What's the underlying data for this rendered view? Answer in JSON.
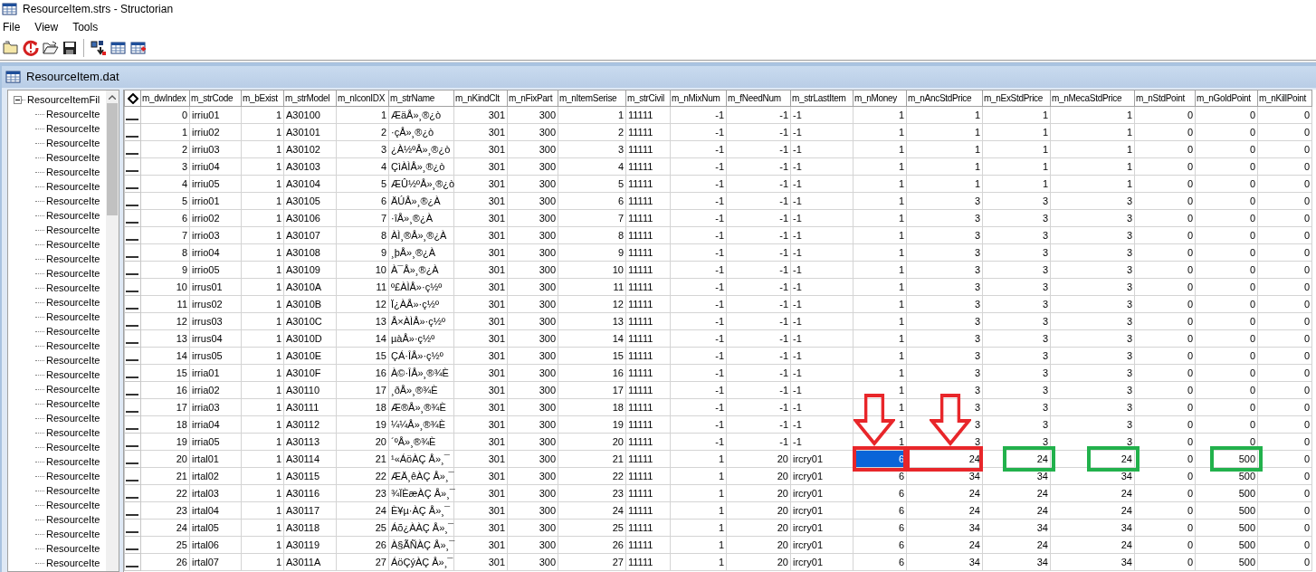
{
  "window": {
    "title": "ResourceItem.strs - Structorian"
  },
  "menu": [
    "File",
    "View",
    "Tools"
  ],
  "child_window": {
    "title": "ResourceItem.dat"
  },
  "tree": {
    "root": {
      "label": "ResourceItemFil",
      "expanded": true,
      "children": [
        "ResourceIte",
        "ResourceIte",
        "ResourceIte",
        "ResourceIte",
        "ResourceIte",
        "ResourceIte",
        "ResourceIte",
        "ResourceIte",
        "ResourceIte",
        "ResourceIte",
        "ResourceIte",
        "ResourceIte",
        "ResourceIte",
        "ResourceIte",
        "ResourceIte",
        "ResourceIte",
        "ResourceIte",
        "ResourceIte",
        "ResourceIte",
        "ResourceIte",
        "ResourceIte",
        "ResourceIte",
        "ResourceIte",
        "ResourceIte",
        "ResourceIte",
        "ResourceIte",
        "ResourceIte",
        "ResourceIte",
        "ResourceIte",
        "ResourceIte",
        "ResourceIte",
        "ResourceIte"
      ]
    }
  },
  "table": {
    "columns": [
      {
        "label": "m_dwIndex",
        "kind": "number",
        "selected": false
      },
      {
        "label": "m_strCode",
        "kind": "text",
        "selected": false
      },
      {
        "label": "m_bExist",
        "kind": "number",
        "selected": false
      },
      {
        "label": "m_strModel",
        "kind": "text",
        "selected": false
      },
      {
        "label": "m_nIconIDX",
        "kind": "number",
        "selected": false
      },
      {
        "label": "m_strName",
        "kind": "text",
        "selected": false
      },
      {
        "label": "m_nKindClt",
        "kind": "number",
        "selected": false
      },
      {
        "label": "m_nFixPart",
        "kind": "number",
        "selected": false
      },
      {
        "label": "m_nItemSerise",
        "kind": "number",
        "selected": false
      },
      {
        "label": "m_strCivil",
        "kind": "text",
        "selected": false
      },
      {
        "label": "m_nMixNum",
        "kind": "number",
        "selected": false
      },
      {
        "label": "m_fNeedNum",
        "kind": "number",
        "selected": false
      },
      {
        "label": "m_strLastItem",
        "kind": "text",
        "selected": false
      },
      {
        "label": "m_nMoney",
        "kind": "number",
        "selected": true,
        "annotation": {
          "kind": "arrow_box",
          "color": "#e8262a"
        }
      },
      {
        "label": "m_nAncStdPrice",
        "kind": "number",
        "selected": false,
        "annotation": {
          "kind": "arrow_box",
          "color": "#e8262a"
        }
      },
      {
        "label": "m_nExStdPrice",
        "kind": "number",
        "selected": false,
        "annotation": {
          "kind": "box",
          "color": "#22b14c"
        }
      },
      {
        "label": "m_nMecaStdPrice",
        "kind": "number",
        "selected": false,
        "annotation": {
          "kind": "box",
          "color": "#22b14c"
        }
      },
      {
        "label": "m_nStdPoint",
        "kind": "number",
        "selected": false
      },
      {
        "label": "m_nGoldPoint",
        "kind": "number",
        "selected": false,
        "annotation": {
          "kind": "box",
          "color": "#22b14c"
        }
      },
      {
        "label": "m_nKillPoint",
        "kind": "number",
        "selected": false
      }
    ],
    "rows": [
      {
        "selected": false,
        "annotated": false,
        "cells": [
          "0",
          "irriu01",
          "1",
          "A30100",
          "1",
          "ÆäÅ»¸®¿ò",
          "301",
          "300",
          "1",
          "11111",
          "-1",
          "-1",
          "-1",
          "1",
          "1",
          "1",
          "1",
          "0",
          "0",
          "0"
        ]
      },
      {
        "selected": false,
        "annotated": false,
        "cells": [
          "1",
          "irriu02",
          "1",
          "A30101",
          "2",
          "·çÅ»¸®¿ò",
          "301",
          "300",
          "2",
          "11111",
          "-1",
          "-1",
          "-1",
          "1",
          "1",
          "1",
          "1",
          "0",
          "0",
          "0"
        ]
      },
      {
        "selected": false,
        "annotated": false,
        "cells": [
          "2",
          "irriu03",
          "1",
          "A30102",
          "3",
          "¿À½ºÅ»¸®¿ò",
          "301",
          "300",
          "3",
          "11111",
          "-1",
          "-1",
          "-1",
          "1",
          "1",
          "1",
          "1",
          "0",
          "0",
          "0"
        ]
      },
      {
        "selected": false,
        "annotated": false,
        "cells": [
          "3",
          "irriu04",
          "1",
          "A30103",
          "4",
          "ÇìÀÌÅ»¸®¿ò",
          "301",
          "300",
          "4",
          "11111",
          "-1",
          "-1",
          "-1",
          "1",
          "1",
          "1",
          "1",
          "0",
          "0",
          "0"
        ]
      },
      {
        "selected": false,
        "annotated": false,
        "cells": [
          "4",
          "irriu05",
          "1",
          "A30104",
          "5",
          "ÆÛ½ºÅ»¸®¿ò",
          "301",
          "300",
          "5",
          "11111",
          "-1",
          "-1",
          "-1",
          "1",
          "1",
          "1",
          "1",
          "0",
          "0",
          "0"
        ]
      },
      {
        "selected": false,
        "annotated": false,
        "cells": [
          "5",
          "irrio01",
          "1",
          "A30105",
          "6",
          "ÄÚÅ»¸®¿À",
          "301",
          "300",
          "6",
          "11111",
          "-1",
          "-1",
          "-1",
          "1",
          "3",
          "3",
          "3",
          "0",
          "0",
          "0"
        ]
      },
      {
        "selected": false,
        "annotated": false,
        "cells": [
          "6",
          "irrio02",
          "1",
          "A30106",
          "7",
          "·îÅ»¸®¿À",
          "301",
          "300",
          "7",
          "11111",
          "-1",
          "-1",
          "-1",
          "1",
          "3",
          "3",
          "3",
          "0",
          "0",
          "0"
        ]
      },
      {
        "selected": false,
        "annotated": false,
        "cells": [
          "7",
          "irrio03",
          "1",
          "A30107",
          "8",
          "ÀÌ¸®Å»¸®¿À",
          "301",
          "300",
          "8",
          "11111",
          "-1",
          "-1",
          "-1",
          "1",
          "3",
          "3",
          "3",
          "0",
          "0",
          "0"
        ]
      },
      {
        "selected": false,
        "annotated": false,
        "cells": [
          "8",
          "irrio04",
          "1",
          "A30108",
          "9",
          "¸þÅ»¸®¿À",
          "301",
          "300",
          "9",
          "11111",
          "-1",
          "-1",
          "-1",
          "1",
          "3",
          "3",
          "3",
          "0",
          "0",
          "0"
        ]
      },
      {
        "selected": false,
        "annotated": false,
        "cells": [
          "9",
          "irrio05",
          "1",
          "A30109",
          "10",
          "À¯Å»¸®¿À",
          "301",
          "300",
          "10",
          "11111",
          "-1",
          "-1",
          "-1",
          "1",
          "3",
          "3",
          "3",
          "0",
          "0",
          "0"
        ]
      },
      {
        "selected": false,
        "annotated": false,
        "cells": [
          "10",
          "irrus01",
          "1",
          "A3010A",
          "11",
          "º£ÀÌÅ»·ç½º",
          "301",
          "300",
          "11",
          "11111",
          "-1",
          "-1",
          "-1",
          "1",
          "3",
          "3",
          "3",
          "0",
          "0",
          "0"
        ]
      },
      {
        "selected": false,
        "annotated": false,
        "cells": [
          "11",
          "irrus02",
          "1",
          "A3010B",
          "12",
          "Ï¿ÀÅ»·ç½º",
          "301",
          "300",
          "12",
          "11111",
          "-1",
          "-1",
          "-1",
          "1",
          "3",
          "3",
          "3",
          "0",
          "0",
          "0"
        ]
      },
      {
        "selected": false,
        "annotated": false,
        "cells": [
          "12",
          "irrus03",
          "1",
          "A3010C",
          "13",
          "Å×ÀÌÅ»·ç½º",
          "301",
          "300",
          "13",
          "11111",
          "-1",
          "-1",
          "-1",
          "1",
          "3",
          "3",
          "3",
          "0",
          "0",
          "0"
        ]
      },
      {
        "selected": false,
        "annotated": false,
        "cells": [
          "13",
          "irrus04",
          "1",
          "A3010D",
          "14",
          "µàÅ»·ç½º",
          "301",
          "300",
          "14",
          "11111",
          "-1",
          "-1",
          "-1",
          "1",
          "3",
          "3",
          "3",
          "0",
          "0",
          "0"
        ]
      },
      {
        "selected": false,
        "annotated": false,
        "cells": [
          "14",
          "irrus05",
          "1",
          "A3010E",
          "15",
          "ÇÁ·ÎÅ»·ç½º",
          "301",
          "300",
          "15",
          "11111",
          "-1",
          "-1",
          "-1",
          "1",
          "3",
          "3",
          "3",
          "0",
          "0",
          "0"
        ]
      },
      {
        "selected": false,
        "annotated": false,
        "cells": [
          "15",
          "irria01",
          "1",
          "A3010F",
          "16",
          "À©·ÎÅ»¸®¾È",
          "301",
          "300",
          "16",
          "11111",
          "-1",
          "-1",
          "-1",
          "1",
          "3",
          "3",
          "3",
          "0",
          "0",
          "0"
        ]
      },
      {
        "selected": false,
        "annotated": false,
        "cells": [
          "16",
          "irria02",
          "1",
          "A30110",
          "17",
          "¸ðÅ»¸®¾È",
          "301",
          "300",
          "17",
          "11111",
          "-1",
          "-1",
          "-1",
          "1",
          "3",
          "3",
          "3",
          "0",
          "0",
          "0"
        ]
      },
      {
        "selected": false,
        "annotated": false,
        "cells": [
          "17",
          "irria03",
          "1",
          "A30111",
          "18",
          "Æ®Å»¸®¾È",
          "301",
          "300",
          "18",
          "11111",
          "-1",
          "-1",
          "-1",
          "1",
          "3",
          "3",
          "3",
          "0",
          "0",
          "0"
        ]
      },
      {
        "selected": false,
        "annotated": false,
        "cells": [
          "18",
          "irria04",
          "1",
          "A30112",
          "19",
          "¼¼Å»¸®¾È",
          "301",
          "300",
          "19",
          "11111",
          "-1",
          "-1",
          "-1",
          "1",
          "3",
          "3",
          "3",
          "0",
          "0",
          "0"
        ]
      },
      {
        "selected": false,
        "annotated": false,
        "cells": [
          "19",
          "irria05",
          "1",
          "A30113",
          "20",
          "´ºÅ»¸®¾È",
          "301",
          "300",
          "20",
          "11111",
          "-1",
          "-1",
          "-1",
          "1",
          "3",
          "3",
          "3",
          "0",
          "0",
          "0"
        ]
      },
      {
        "selected": true,
        "annotated": true,
        "cells": [
          "20",
          "irtal01",
          "1",
          "A30114",
          "21",
          "¹«ÁöÀÇ Å»¸¯",
          "301",
          "300",
          "21",
          "11111",
          "1",
          "20",
          "ircry01",
          "6",
          "24",
          "24",
          "24",
          "0",
          "500",
          "0"
        ]
      },
      {
        "selected": false,
        "annotated": false,
        "cells": [
          "21",
          "irtal02",
          "1",
          "A30115",
          "22",
          "ÆÄ¸êÀÇ Å»¸¯",
          "301",
          "300",
          "22",
          "11111",
          "1",
          "20",
          "ircry01",
          "6",
          "34",
          "34",
          "34",
          "0",
          "500",
          "0"
        ]
      },
      {
        "selected": false,
        "annotated": false,
        "cells": [
          "22",
          "irtal03",
          "1",
          "A30116",
          "23",
          "¾ÏÈæÀÇ Å»¸¯",
          "301",
          "300",
          "23",
          "11111",
          "1",
          "20",
          "ircry01",
          "6",
          "24",
          "24",
          "24",
          "0",
          "500",
          "0"
        ]
      },
      {
        "selected": false,
        "annotated": false,
        "cells": [
          "23",
          "irtal04",
          "1",
          "A30117",
          "24",
          "È¥µ·ÀÇ Å»¸¯",
          "301",
          "300",
          "24",
          "11111",
          "1",
          "20",
          "ircry01",
          "6",
          "24",
          "24",
          "24",
          "0",
          "500",
          "0"
        ]
      },
      {
        "selected": false,
        "annotated": false,
        "cells": [
          "24",
          "irtal05",
          "1",
          "A30118",
          "25",
          "Áõ¿ÀÀÇ Å»¸¯",
          "301",
          "300",
          "25",
          "11111",
          "1",
          "20",
          "ircry01",
          "6",
          "34",
          "34",
          "34",
          "0",
          "500",
          "0"
        ]
      },
      {
        "selected": false,
        "annotated": false,
        "cells": [
          "25",
          "irtal06",
          "1",
          "A30119",
          "26",
          "À§ÃÑÀÇ Å»¸¯",
          "301",
          "300",
          "26",
          "11111",
          "1",
          "20",
          "ircry01",
          "6",
          "24",
          "24",
          "24",
          "0",
          "500",
          "0"
        ]
      },
      {
        "selected": false,
        "annotated": false,
        "cells": [
          "26",
          "irtal07",
          "1",
          "A3011A",
          "27",
          "ÁöÇýÀÇ Å»¸¯",
          "301",
          "300",
          "27",
          "11111",
          "1",
          "20",
          "ircry01",
          "6",
          "34",
          "34",
          "34",
          "0",
          "500",
          "0"
        ]
      }
    ]
  }
}
